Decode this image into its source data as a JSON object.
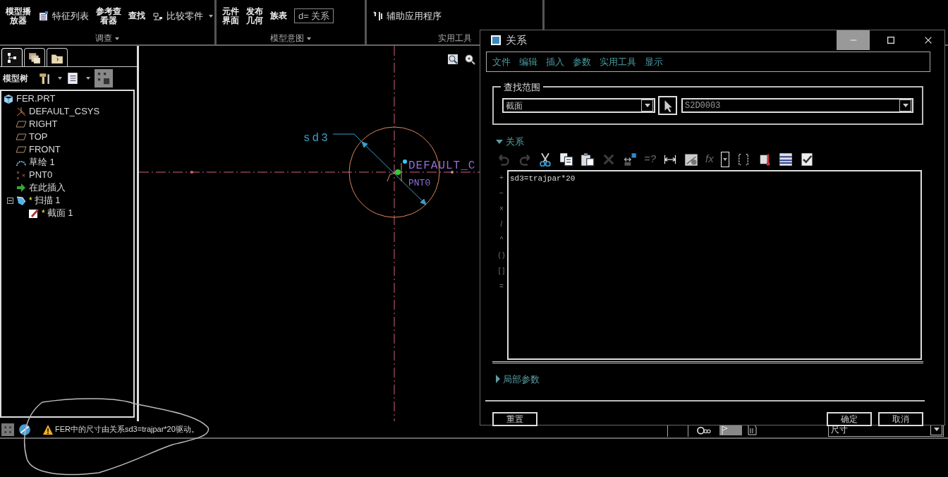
{
  "ribbon": {
    "groups": [
      {
        "label": "调查",
        "dropdown": true,
        "items": [
          {
            "kind": "large",
            "lines": [
              "模型播",
              "放器"
            ]
          },
          {
            "kind": "small",
            "label": "特征列表",
            "dropdown": false
          },
          {
            "kind": "large",
            "lines": [
              "参考查",
              "看器"
            ]
          },
          {
            "kind": "large",
            "lines": [
              "查找"
            ]
          },
          {
            "kind": "small",
            "label": "比较零件",
            "dropdown": true
          }
        ]
      },
      {
        "label": "模型意图",
        "dropdown": true,
        "items": [
          {
            "kind": "large",
            "lines": [
              "元件",
              "界面"
            ]
          },
          {
            "kind": "large",
            "lines": [
              "发布",
              "几何"
            ]
          },
          {
            "kind": "large",
            "lines": [
              "族表"
            ]
          },
          {
            "kind": "boxed",
            "label": "d= 关系"
          }
        ]
      },
      {
        "label": "实用工具",
        "dropdown": false,
        "items": [
          {
            "kind": "small",
            "label": "辅助应用程序",
            "dropdown": false
          }
        ]
      }
    ]
  },
  "model_tree": {
    "tabs": [
      {
        "selected": true
      },
      {
        "selected": false
      },
      {
        "selected": false
      }
    ],
    "title": "模型树",
    "items": [
      {
        "kind": "part",
        "label": "FER.PRT",
        "children": [
          {
            "kind": "csys",
            "label": "DEFAULT_CSYS"
          },
          {
            "kind": "plane",
            "label": "RIGHT"
          },
          {
            "kind": "plane",
            "label": "TOP"
          },
          {
            "kind": "plane",
            "label": "FRONT"
          },
          {
            "kind": "sketch",
            "label": "草绘 1"
          },
          {
            "kind": "point",
            "label": "PNT0"
          },
          {
            "kind": "insert",
            "label": "在此插入"
          },
          {
            "kind": "sweep",
            "label": "扫描 1",
            "flag": "*",
            "expanded": true,
            "children": [
              {
                "kind": "section",
                "label": "截面 1",
                "flag": "*"
              }
            ]
          }
        ]
      }
    ]
  },
  "canvas": {
    "dimension_label": "sd3",
    "csys_label": "DEFAULT_C",
    "point_label": "PNT0"
  },
  "dialog": {
    "title": "关系",
    "menus": [
      "文件",
      "编辑",
      "插入",
      "参数",
      "实用工具",
      "显示"
    ],
    "scope": {
      "legend": "查找范围",
      "type": "截面",
      "item": "S2D0003"
    },
    "relations": {
      "label": "关系",
      "expanded": true,
      "tools": [
        {
          "kind": "undo",
          "disabled": true
        },
        {
          "kind": "redo",
          "disabled": true
        },
        {
          "kind": "cut",
          "disabled": false
        },
        {
          "kind": "copy",
          "disabled": false
        },
        {
          "kind": "paste",
          "disabled": false
        },
        {
          "kind": "delete",
          "disabled": true
        },
        {
          "kind": "evaluate",
          "disabled": false
        },
        {
          "kind": "text",
          "text": "=?",
          "disabled": true
        },
        {
          "kind": "dimension",
          "disabled": false
        },
        {
          "kind": "units",
          "disabled": false
        },
        {
          "kind": "text",
          "text": "fx",
          "disabled": true
        },
        {
          "kind": "dropdown",
          "disabled": false
        },
        {
          "kind": "brackets",
          "disabled": false
        },
        {
          "kind": "thermo",
          "disabled": false
        },
        {
          "kind": "sort",
          "disabled": false
        },
        {
          "kind": "verify",
          "disabled": false
        }
      ],
      "operators": [
        "+",
        "−",
        "×",
        "/",
        "^",
        "( )",
        "[ ]",
        "="
      ],
      "text": "sd3=trajpar*20"
    },
    "local_params": {
      "label": "局部参数",
      "expanded": false
    },
    "buttons": [
      "重置",
      "确定",
      "取消"
    ]
  },
  "status_bar": {
    "message": "FER中的尺寸由关系sd3=trajpar*20驱动。",
    "filter": "尺寸"
  }
}
